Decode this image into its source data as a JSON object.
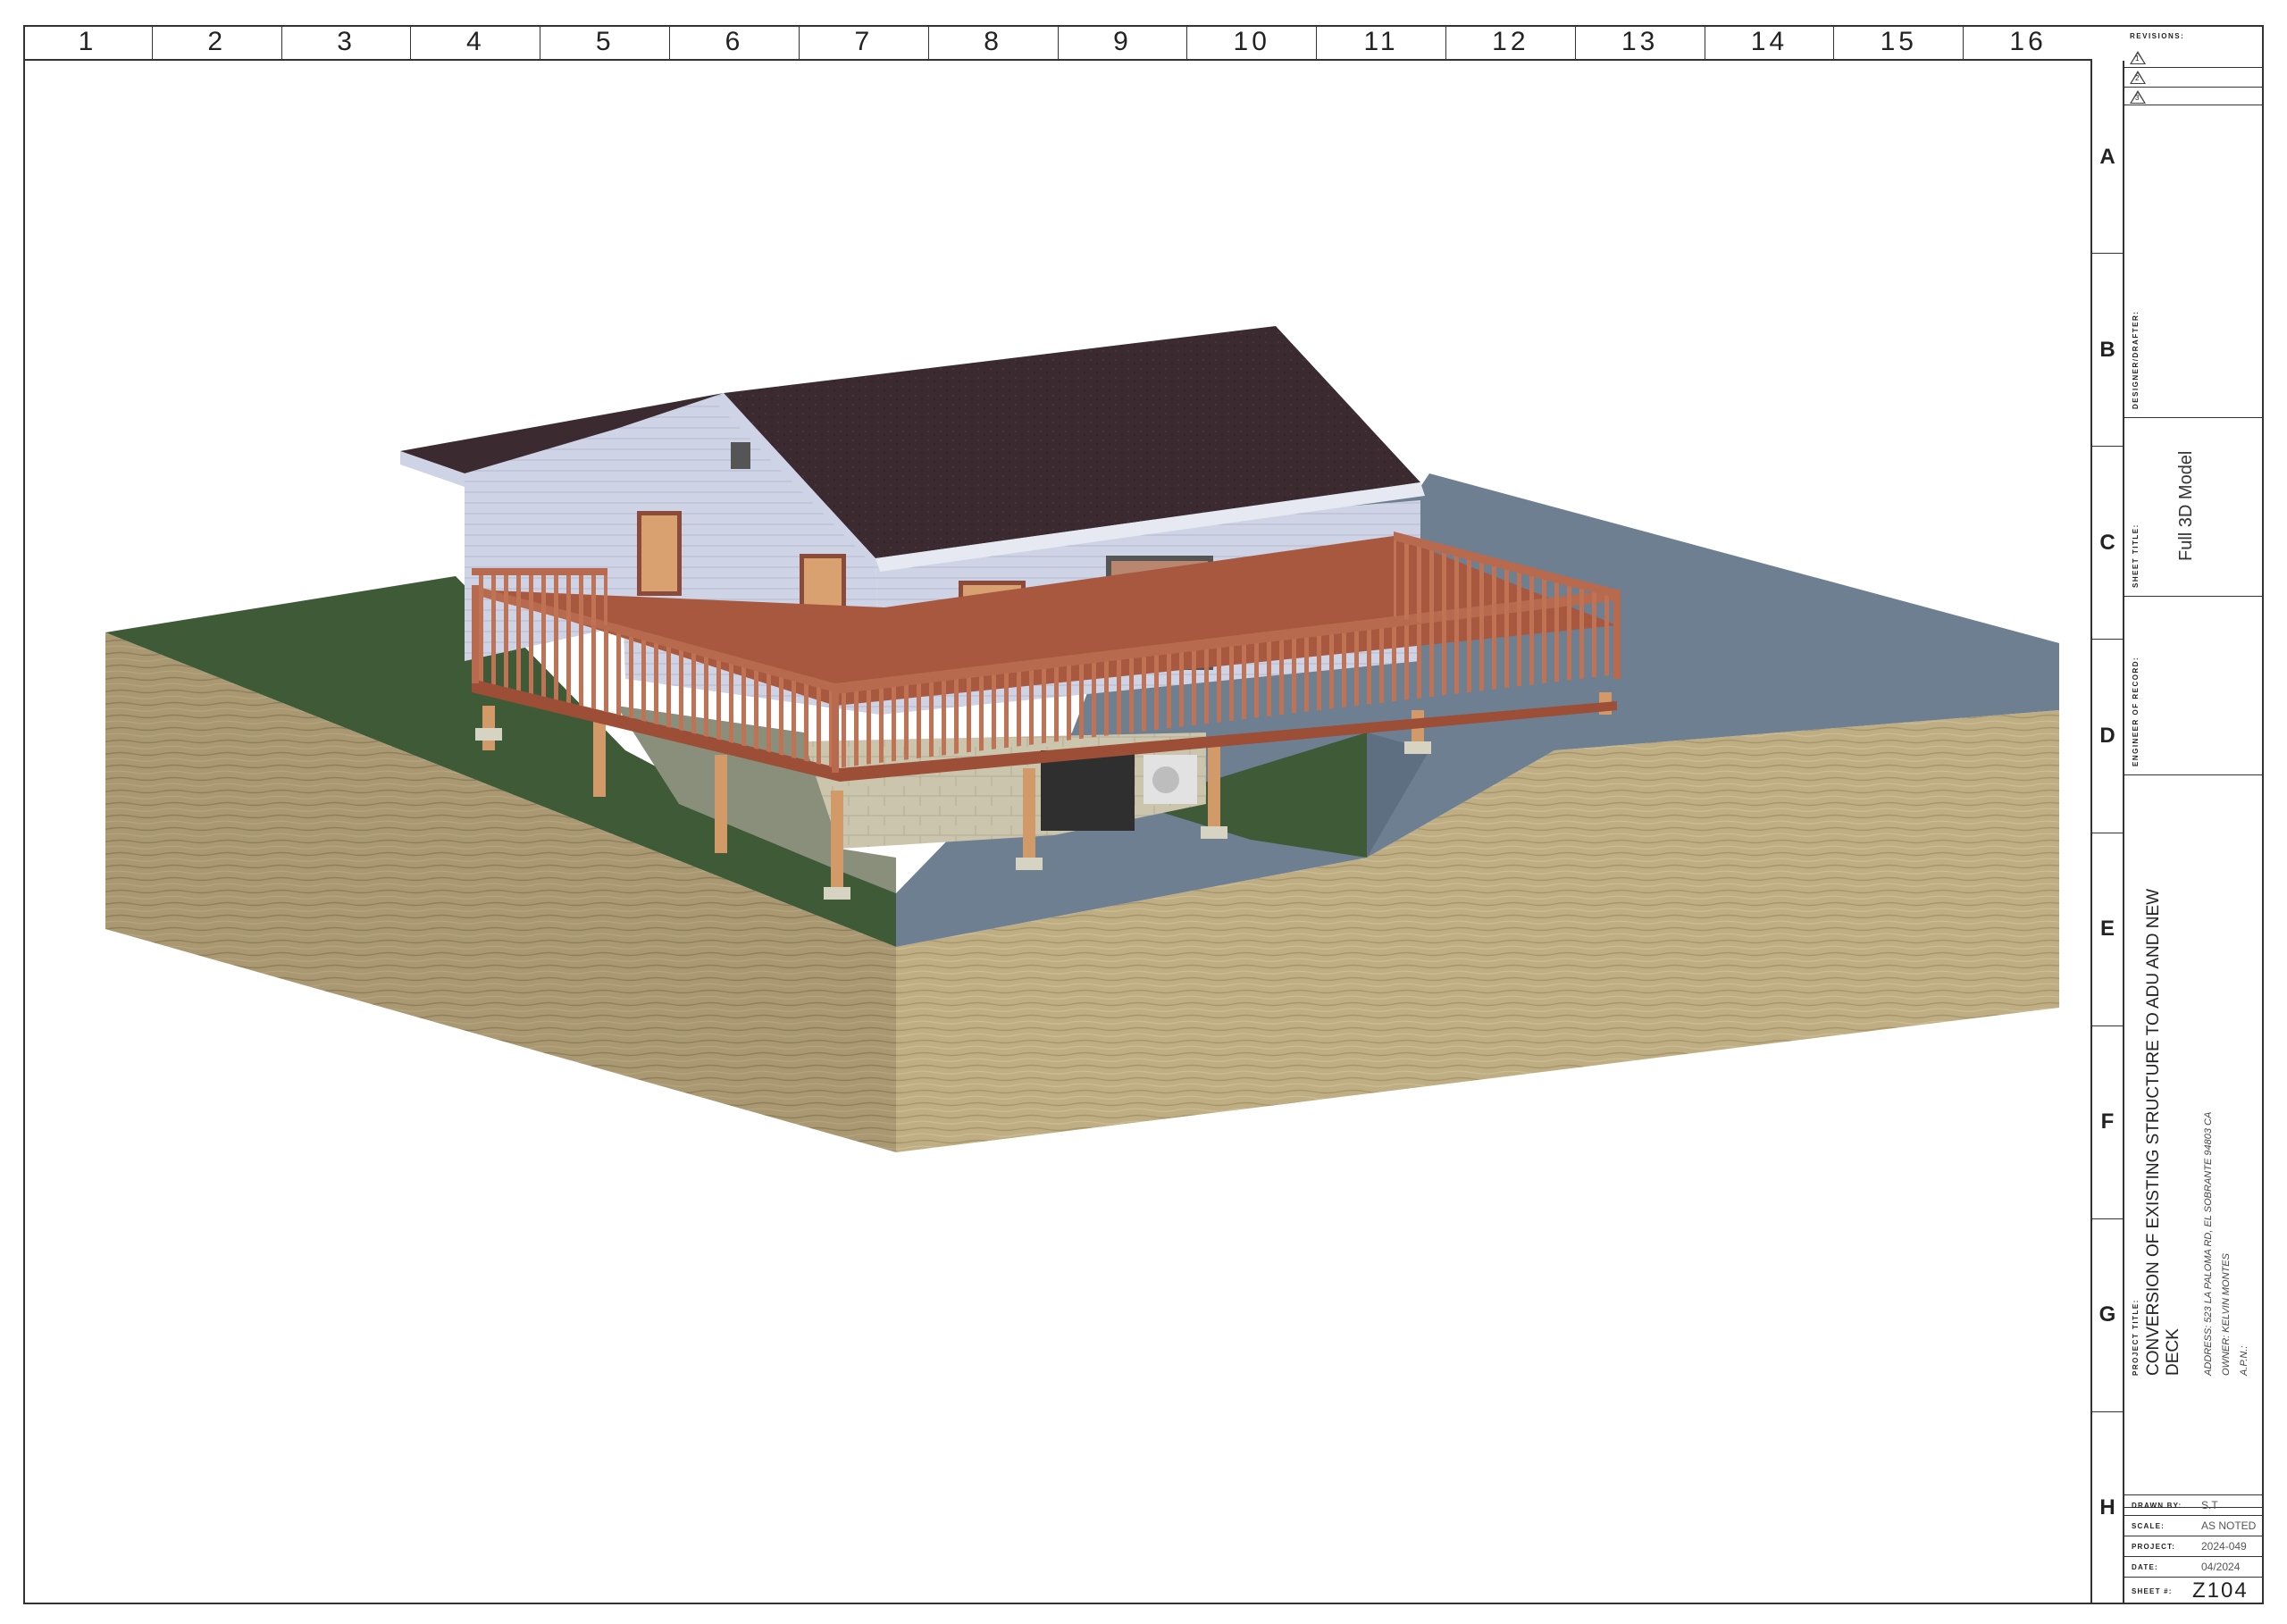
{
  "grid": {
    "columns": [
      "1",
      "2",
      "3",
      "4",
      "5",
      "6",
      "7",
      "8",
      "9",
      "10",
      "11",
      "12",
      "13",
      "14",
      "15",
      "16"
    ],
    "rows": [
      "A",
      "B",
      "C",
      "D",
      "E",
      "F",
      "G",
      "H"
    ]
  },
  "title_block": {
    "revisions_label": "REVISIONS:",
    "revisions": [
      "1",
      "2",
      "3"
    ],
    "designer_label": "DESIGNER/DRAFTER:",
    "sheet_title_label": "SHEET TITLE:",
    "sheet_title": "Full 3D Model",
    "engineer_label": "ENGINEER OF RECORD:",
    "project_title_label": "PROJECT TITLE:",
    "project_title_line1": "CONVERSION OF EXISTING STRUCTURE TO ADU  AND  NEW",
    "project_title_line2": "DECK",
    "address": "ADDRESS:    523 LA PALOMA RD, EL SOBRANTE 94803 CA",
    "owner": "OWNER:      KELVIN MONTES",
    "apn": "A.P.N.:",
    "drawn_by_label": "DRAWN BY:",
    "drawn_by": "S.T",
    "scale_label": "SCALE:",
    "scale": "AS NOTED",
    "project_label": "PROJECT:",
    "project": "2024-049",
    "date_label": "DATE:",
    "date": "04/2024",
    "sheet_label": "SHEET #:",
    "sheet_number": "Z104"
  },
  "colors": {
    "ground_front": "#bfae83",
    "grass": "#3f5a36",
    "driveway": "#6d7f90",
    "roof": "#3b2a30",
    "siding": "#cfd3e6",
    "deck": "#b86a4e",
    "post": "#d19a68",
    "foundation": "#cbc5ad"
  }
}
